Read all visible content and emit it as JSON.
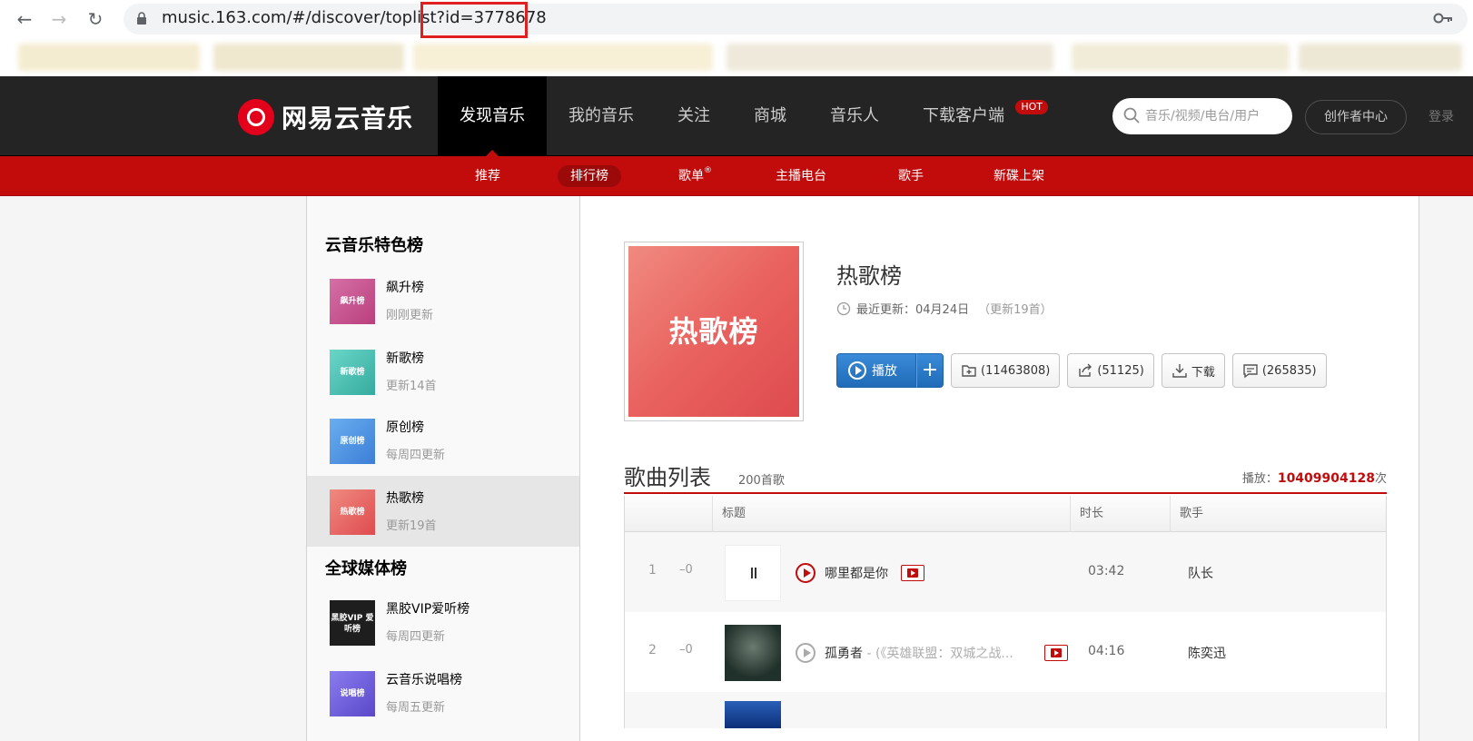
{
  "browser": {
    "url": "music.163.com/#/discover/toplist?id=3778678",
    "back_icon": "←",
    "forward_icon": "→",
    "reload_icon": "↻"
  },
  "header": {
    "logo_text": "网易云音乐",
    "nav": [
      {
        "label": "发现音乐",
        "active": true
      },
      {
        "label": "我的音乐"
      },
      {
        "label": "关注"
      },
      {
        "label": "商城"
      },
      {
        "label": "音乐人"
      },
      {
        "label": "下载客户端"
      }
    ],
    "hot_badge": "HOT",
    "search_placeholder": "音乐/视频/电台/用户",
    "creator_center": "创作者中心",
    "login": "登录"
  },
  "subnav": {
    "items": [
      "推荐",
      "排行榜",
      "歌单",
      "主播电台",
      "歌手",
      "新碟上架"
    ],
    "registered_mark": "®"
  },
  "sidebar": {
    "section1_title": "云音乐特色榜",
    "section2_title": "全球媒体榜",
    "items": [
      {
        "name": "飙升榜",
        "sub": "刚刚更新",
        "thumb": "飙升榜",
        "color": "#c8508e"
      },
      {
        "name": "新歌榜",
        "sub": "更新14首",
        "thumb": "新歌榜",
        "color": "#4dc1b5"
      },
      {
        "name": "原创榜",
        "sub": "每周四更新",
        "thumb": "原创榜",
        "color": "#4d8fe0"
      },
      {
        "name": "热歌榜",
        "sub": "更新19首",
        "thumb": "热歌榜",
        "color": "#e7615e",
        "active": true
      },
      {
        "name": "黑胶VIP爱听榜",
        "sub": "每周四更新",
        "thumb": "黑胶VIP 爱听榜",
        "color": "#1e1e1e"
      },
      {
        "name": "云音乐说唱榜",
        "sub": "每周五更新",
        "thumb": "说唱榜",
        "color": "#6a5ad8"
      }
    ]
  },
  "toplist": {
    "cover_text": "热歌榜",
    "title": "热歌榜",
    "update_label": "最近更新：04月24日",
    "update_count": "（更新19首）",
    "play_label": "播放",
    "add_label": "+",
    "collect_count": "(11463808)",
    "share_count": "(51125)",
    "download_label": "下载",
    "comment_count": "(265835)"
  },
  "song_list": {
    "title": "歌曲列表",
    "count": "200首歌",
    "play_prefix": "播放：",
    "play_total": "10409904128",
    "play_suffix": "次",
    "columns": [
      "标题",
      "时长",
      "歌手"
    ],
    "rows": [
      {
        "rank": "1",
        "trend": "–0",
        "name": "哪里都是你",
        "alias": "",
        "duration": "03:42",
        "artist": "队长"
      },
      {
        "rank": "2",
        "trend": "–0",
        "name": "孤勇者",
        "alias": " - (《英雄联盟：双城之战...",
        "duration": "04:16",
        "artist": "陈奕迅"
      }
    ]
  }
}
